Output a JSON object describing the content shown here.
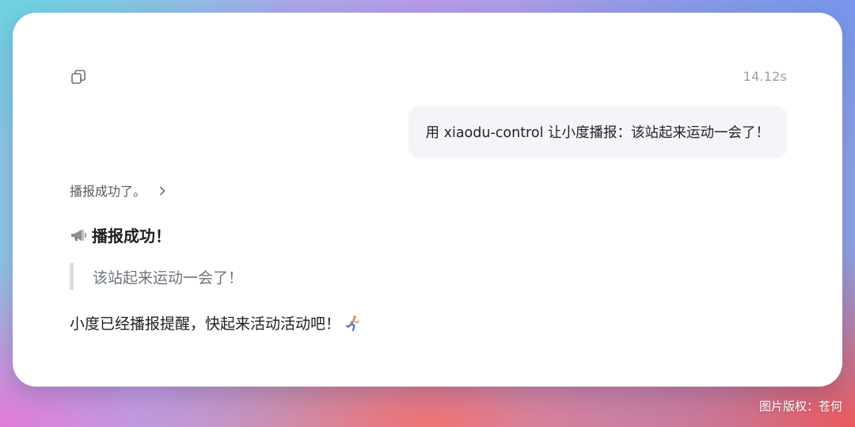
{
  "message_meta": {
    "response_time": "14.12s",
    "copy_icon": "copy-icon"
  },
  "user_message": {
    "text": "用 xiaodu-control 让小度播报：该站起来运动一会了！"
  },
  "assistant": {
    "thought_summary": "播报成功了。",
    "thought_toggle_icon": "chevron-right-icon",
    "heading_icon": "megaphone-icon",
    "heading": "播报成功！",
    "quote": "该站起来运动一会了！",
    "body": "小度已经播报提醒，快起来活动活动吧！",
    "body_emoji_icon": "runner-icon"
  },
  "watermark": "图片版权：苍何",
  "colors": {
    "card_background": "#ffffff",
    "user_bubble_background": "#f3f5f8",
    "quote_bar": "#d9dde2",
    "muted_text": "#9aa0a8"
  }
}
